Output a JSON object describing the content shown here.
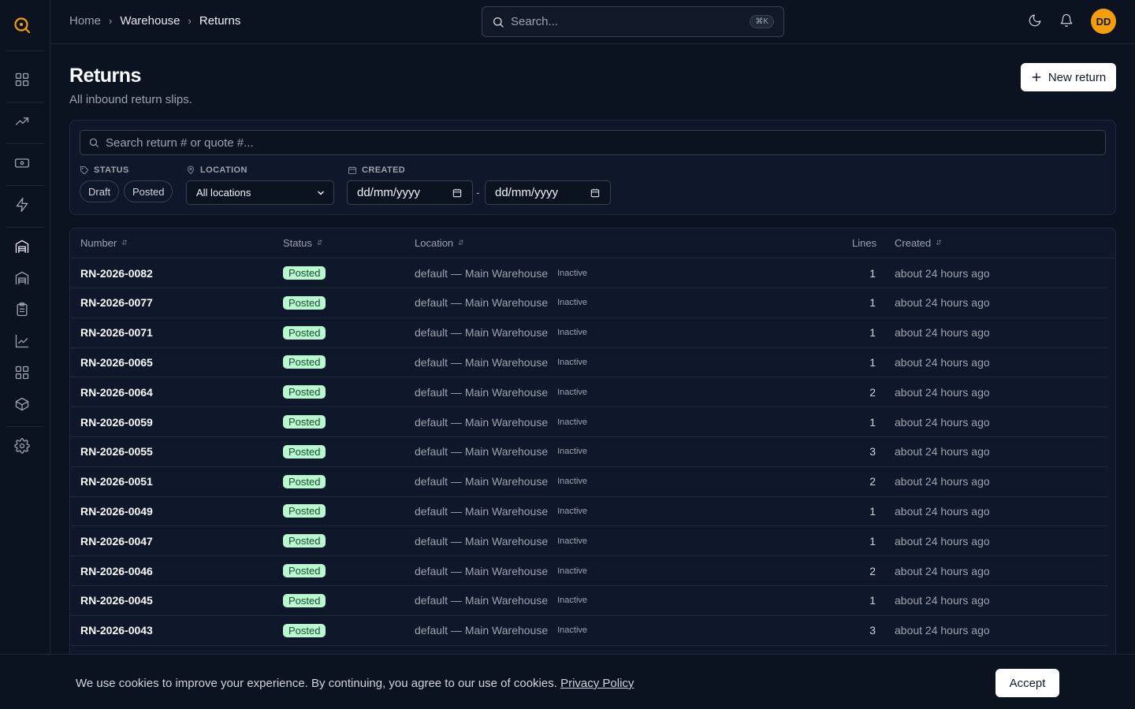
{
  "breadcrumb": {
    "home": "Home",
    "warehouse": "Warehouse",
    "current": "Returns"
  },
  "global_search": {
    "placeholder": "Search...",
    "shortcut": "⌘K"
  },
  "user": {
    "initials": "DD"
  },
  "page": {
    "title": "Returns",
    "subtitle": "All inbound return slips."
  },
  "actions": {
    "new_return": "New return"
  },
  "filters": {
    "search_placeholder": "Search return # or quote #...",
    "status_label": "STATUS",
    "status_options": [
      "Draft",
      "Posted"
    ],
    "location_label": "LOCATION",
    "location_value": "All locations",
    "created_label": "CREATED",
    "date_from": "dd/mm/yyyy",
    "date_to": "dd/mm/yyyy",
    "date_sep": "-"
  },
  "table": {
    "columns": {
      "number": "Number",
      "status": "Status",
      "location": "Location",
      "lines": "Lines",
      "created": "Created"
    },
    "rows": [
      {
        "number": "RN-2026-0082",
        "status": "Posted",
        "location": "default — Main Warehouse",
        "loc_state": "Inactive",
        "lines": "1",
        "created": "about 24 hours ago"
      },
      {
        "number": "RN-2026-0077",
        "status": "Posted",
        "location": "default — Main Warehouse",
        "loc_state": "Inactive",
        "lines": "1",
        "created": "about 24 hours ago"
      },
      {
        "number": "RN-2026-0071",
        "status": "Posted",
        "location": "default — Main Warehouse",
        "loc_state": "Inactive",
        "lines": "1",
        "created": "about 24 hours ago"
      },
      {
        "number": "RN-2026-0065",
        "status": "Posted",
        "location": "default — Main Warehouse",
        "loc_state": "Inactive",
        "lines": "1",
        "created": "about 24 hours ago"
      },
      {
        "number": "RN-2026-0064",
        "status": "Posted",
        "location": "default — Main Warehouse",
        "loc_state": "Inactive",
        "lines": "2",
        "created": "about 24 hours ago"
      },
      {
        "number": "RN-2026-0059",
        "status": "Posted",
        "location": "default — Main Warehouse",
        "loc_state": "Inactive",
        "lines": "1",
        "created": "about 24 hours ago"
      },
      {
        "number": "RN-2026-0055",
        "status": "Posted",
        "location": "default — Main Warehouse",
        "loc_state": "Inactive",
        "lines": "3",
        "created": "about 24 hours ago"
      },
      {
        "number": "RN-2026-0051",
        "status": "Posted",
        "location": "default — Main Warehouse",
        "loc_state": "Inactive",
        "lines": "2",
        "created": "about 24 hours ago"
      },
      {
        "number": "RN-2026-0049",
        "status": "Posted",
        "location": "default — Main Warehouse",
        "loc_state": "Inactive",
        "lines": "1",
        "created": "about 24 hours ago"
      },
      {
        "number": "RN-2026-0047",
        "status": "Posted",
        "location": "default — Main Warehouse",
        "loc_state": "Inactive",
        "lines": "1",
        "created": "about 24 hours ago"
      },
      {
        "number": "RN-2026-0046",
        "status": "Posted",
        "location": "default — Main Warehouse",
        "loc_state": "Inactive",
        "lines": "2",
        "created": "about 24 hours ago"
      },
      {
        "number": "RN-2026-0045",
        "status": "Posted",
        "location": "default — Main Warehouse",
        "loc_state": "Inactive",
        "lines": "1",
        "created": "about 24 hours ago"
      },
      {
        "number": "RN-2026-0043",
        "status": "Posted",
        "location": "default — Main Warehouse",
        "loc_state": "Inactive",
        "lines": "3",
        "created": "about 24 hours ago"
      }
    ]
  },
  "cookie": {
    "text": "We use cookies to improve your experience. By continuing, you agree to our use of cookies.",
    "link": "Privacy Policy",
    "accept": "Accept"
  },
  "colors": {
    "accent": "#f59e0b",
    "background": "#0b1220",
    "posted_badge": "#bbf7d0"
  },
  "icons": [
    "search-icon",
    "dashboard-icon",
    "trending-icon",
    "money-icon",
    "bolt-icon",
    "warehouse-icon",
    "clipboard-icon",
    "chart-icon",
    "grid-icon",
    "package-icon",
    "settings-icon",
    "moon-icon",
    "bell-icon"
  ]
}
